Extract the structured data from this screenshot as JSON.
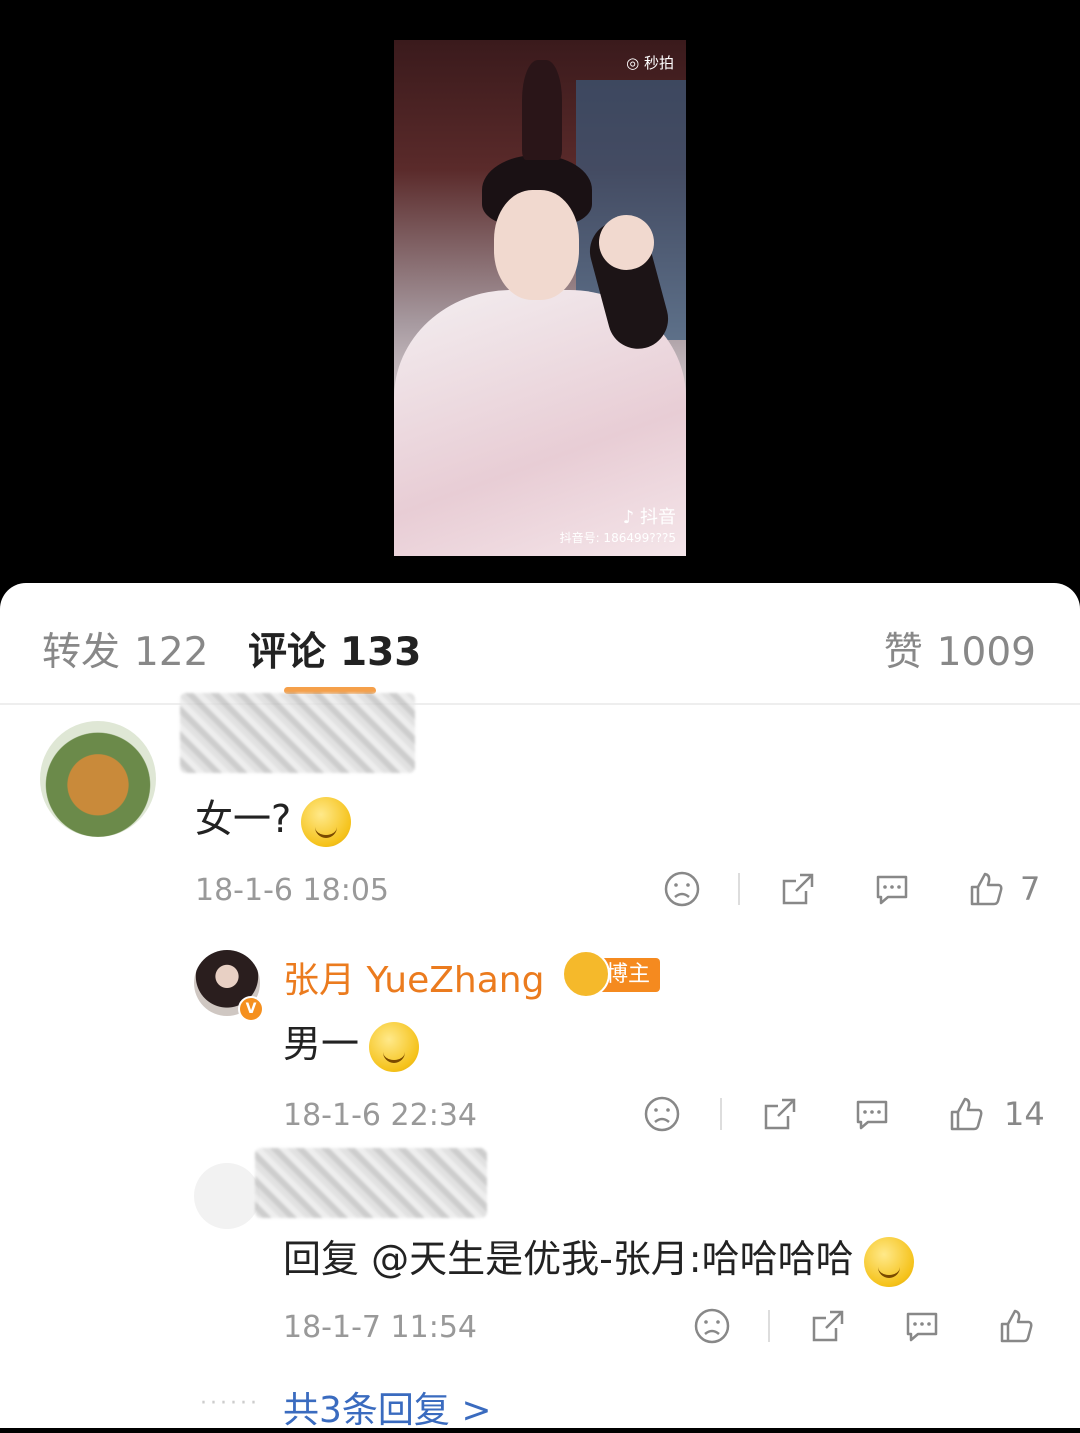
{
  "video": {
    "watermark_top": "秒拍",
    "watermark_brand": "抖音",
    "watermark_id": "抖音号: 186499???5"
  },
  "tabs": {
    "repost_label": "转发",
    "repost_count": "122",
    "comment_label": "评论",
    "comment_count": "133",
    "like_label": "赞",
    "like_count": "1009"
  },
  "comments": [
    {
      "text": "女一?",
      "timestamp": "18-1-6 18:05",
      "like_count": "7"
    }
  ],
  "replies": [
    {
      "author": "张月 YueZhang",
      "badge": "博主",
      "text": "男一",
      "timestamp": "18-1-6 22:34",
      "like_count": "14"
    },
    {
      "text": "回复 @天生是优我-张月:哈哈哈哈",
      "timestamp": "18-1-7 11:54",
      "like_count": ""
    }
  ],
  "more_replies": "共3条回复 >",
  "colors": {
    "accent": "#f5a04a",
    "name": "#eb7b1e",
    "link": "#3a6bbf"
  }
}
